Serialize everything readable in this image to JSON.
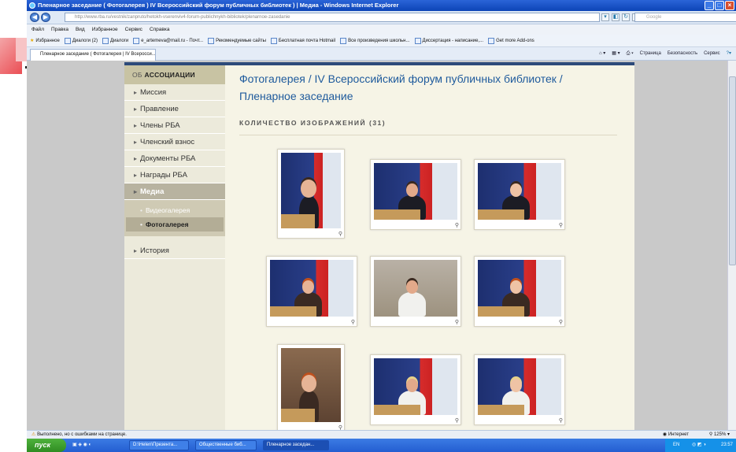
{
  "browser": {
    "title": "Пленарное заседание ( Фотогалерея ) IV Всероссийский форум публичных библиотек ) | Медиа - Windows Internet Explorer",
    "url": "http://www.rba.ru/vestnik/zanpruto/hetokh-vserenviv4-forum-publichnykh-bibliotek/plenarnoe-zasedanie",
    "url_domain": "rba.ru",
    "search_placeholder": "Google",
    "menu": [
      "Файл",
      "Правка",
      "Вид",
      "Избранное",
      "Сервис",
      "Справка"
    ],
    "favorites": [
      "Избранное",
      "Диалоги (2)",
      "Диалоги",
      "e_artemeva@mail.ru - Почт...",
      "Рекомендуемые сайты",
      "Бесплатная почта Hotmail",
      "Все произведения школьн...",
      "Диссертация - написание,...",
      "Get more Add-ons"
    ],
    "tab_label": "Пленарное заседание ( Фотогалерея | IV Всеросси...",
    "commands": [
      "Страница",
      "Безопасность",
      "Сервис"
    ],
    "status_text": "Выполнено, но с ошибками на странице.",
    "status_zone": "Интернет",
    "zoom": "125%"
  },
  "sidebar": {
    "heading_prefix": "ОБ",
    "heading": "АССОЦИАЦИИ",
    "items": [
      "Миссия",
      "Правление",
      "Члены РБА",
      "Членский взнос",
      "Документы РБА",
      "Награды РБА"
    ],
    "active_item": "Медиа",
    "subitems": [
      "Видеогалерея",
      "Фотогалерея"
    ],
    "after_items": [
      "История"
    ]
  },
  "main": {
    "title": "Фотогалерея / IV Всероссийский форум публичных библиотек / Пленарное заседание",
    "count_label": "КОЛИЧЕСТВО ИЗОБРАЖЕНИЙ (31)"
  },
  "taskbar": {
    "start": "пуск",
    "tasks": [
      "D:\\Helen\\Презента...",
      "Общественные биб...",
      "Пленарное заседан..."
    ],
    "lang": "EN",
    "clock": "23:57"
  }
}
